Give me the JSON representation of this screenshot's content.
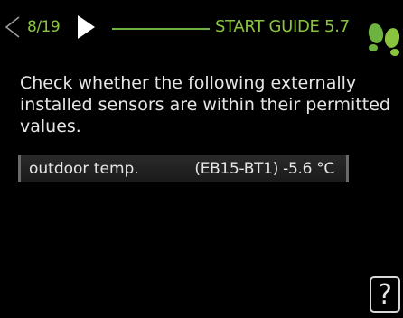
{
  "header": {
    "page_counter": "8/19",
    "title": "START GUIDE 5.7",
    "accent_color": "#8ac43f",
    "prev_icon": "chevron-left-outline-icon",
    "next_icon": "play-right-icon",
    "logo_icon": "footprints-icon"
  },
  "main": {
    "instruction": "Check whether the following externally installed sensors are within their permitted values.",
    "sensors": [
      {
        "name": "outdoor temp.",
        "value": "(EB15-BT1) -5.6 °C"
      }
    ]
  },
  "footer": {
    "help_label": "?",
    "help_icon": "help-question-icon"
  }
}
